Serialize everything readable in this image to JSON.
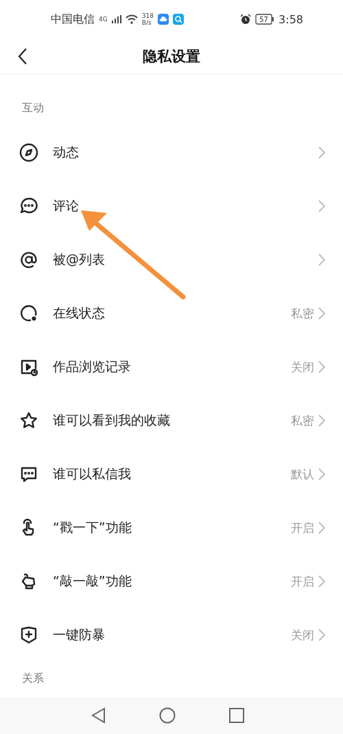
{
  "status_bar": {
    "carrier": "中国电信",
    "network": "4G",
    "speed_value": "318",
    "speed_unit": "B/s",
    "battery": "57",
    "time": "3:58"
  },
  "header": {
    "title": "隐私设置"
  },
  "sections": [
    {
      "title": "互动",
      "items": [
        {
          "label": "动态"
        },
        {
          "label": "评论"
        },
        {
          "label": "被@列表"
        },
        {
          "label": "在线状态",
          "value": "私密"
        },
        {
          "label": "作品浏览记录",
          "value": "关闭"
        },
        {
          "label": "谁可以看到我的收藏",
          "value": "私密"
        },
        {
          "label": "谁可以私信我",
          "value": "默认"
        },
        {
          "label": "“戳一下”功能",
          "value": "开启"
        },
        {
          "label": "“敲一敲”功能",
          "value": "开启"
        },
        {
          "label": "一键防暴",
          "value": "关闭"
        }
      ]
    },
    {
      "title": "关系"
    }
  ]
}
